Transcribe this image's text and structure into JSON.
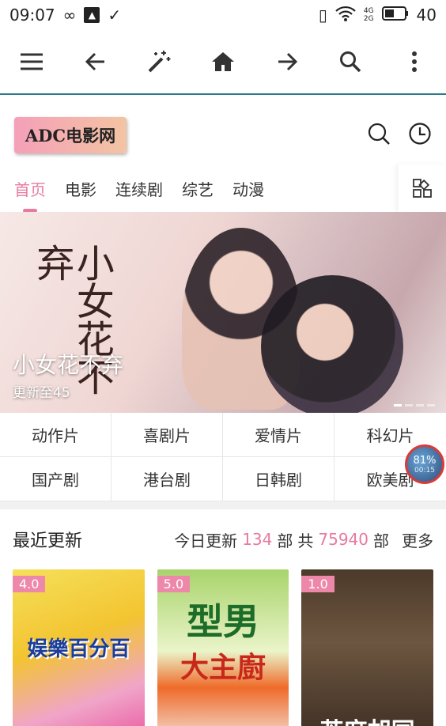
{
  "status": {
    "time": "09:07",
    "battery": "40",
    "net_a": "4G",
    "net_b": "2G"
  },
  "banner": {
    "calligraphy": "小女花不弃",
    "title": "小女花不弃",
    "subtitle": "更新至45"
  },
  "tabs": [
    "首页",
    "电影",
    "连续剧",
    "综艺",
    "动漫"
  ],
  "categories": [
    "动作片",
    "喜剧片",
    "爱情片",
    "科幻片",
    "国产剧",
    "港台剧",
    "日韩剧",
    "欧美剧"
  ],
  "floating": {
    "percent": "81%",
    "time": "00:15"
  },
  "section": {
    "title": "最近更新",
    "today_label": "今日更新",
    "today_count": "134",
    "unit": "部",
    "total_label": "共",
    "total_count": "75940",
    "more": "更多"
  },
  "posters": [
    {
      "score": "4.0",
      "title": "娱樂百分百"
    },
    {
      "score": "5.0",
      "title_a": "型男",
      "title_b": "大主廚"
    },
    {
      "score": "1.0",
      "title": "芝麻胡同"
    }
  ],
  "logo_text": "ADC电影网"
}
